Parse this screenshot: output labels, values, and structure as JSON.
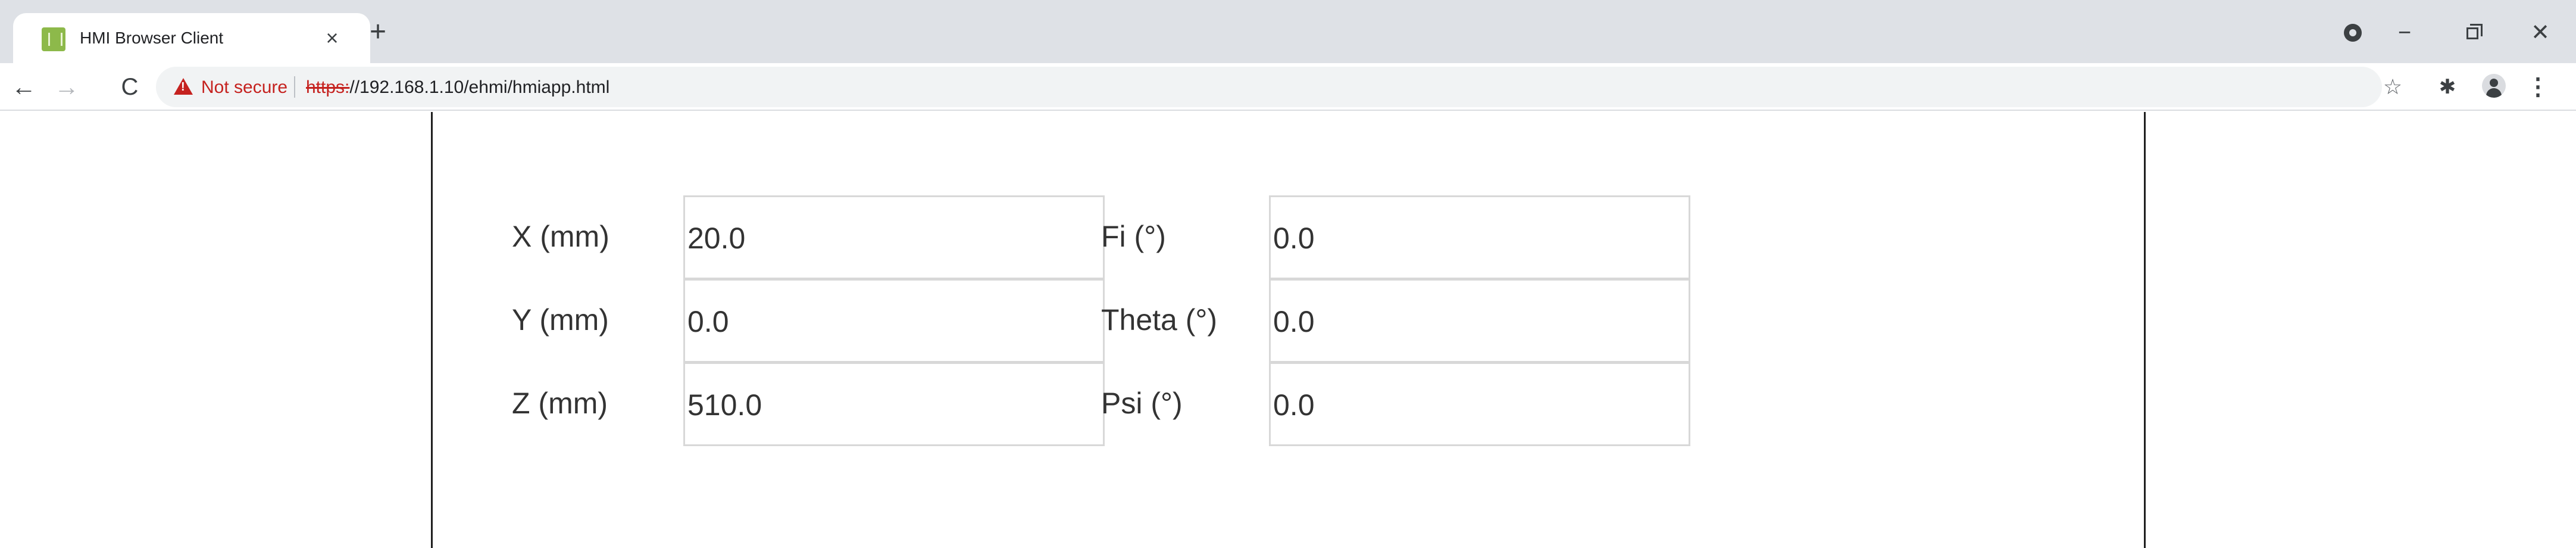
{
  "browser": {
    "tab": {
      "title": "HMI Browser Client",
      "close_glyph": "×",
      "favicon": "hmi-logo-icon"
    },
    "new_tab_glyph": "+",
    "window_controls": {
      "minimize": "−",
      "close": "✕"
    },
    "nav": {
      "back": "←",
      "forward": "→",
      "reload": "C"
    },
    "security": {
      "label": "Not secure",
      "color": "#c5221f"
    },
    "url": {
      "scheme": "https:",
      "rest": "//192.168.1.10/ehmi/hmiapp.html"
    },
    "toolbar_icons": {
      "bookmark": "☆",
      "extensions": "✱",
      "menu": "⋮"
    }
  },
  "pose": {
    "rows": [
      {
        "left_label": "X (mm)",
        "left_value": "20.0",
        "right_label": "Fi (°)",
        "right_value": "0.0"
      },
      {
        "left_label": "Y (mm)",
        "left_value": "0.0",
        "right_label": "Theta (°)",
        "right_value": "0.0"
      },
      {
        "left_label": "Z (mm)",
        "left_value": "510.0",
        "right_label": "Psi (°)",
        "right_value": "0.0"
      }
    ]
  }
}
